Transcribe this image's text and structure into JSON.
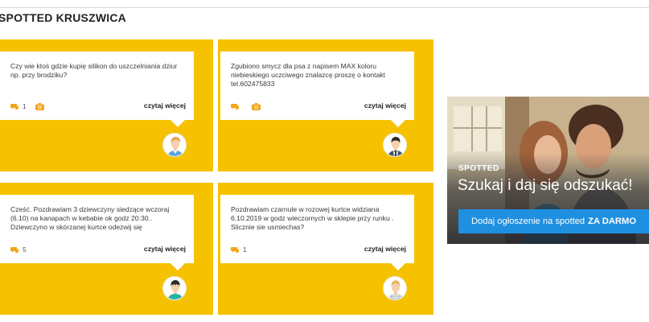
{
  "section": {
    "title": "SPOTTED KRUSZWICA"
  },
  "posts": [
    {
      "text": "Czy wie ktoś gdzie kupię silikon do uszczelniania dziur np. przy brodziku?",
      "comments": "1",
      "has_photo": true,
      "read_more": "czytaj więcej",
      "avatar": "young-man-avatar"
    },
    {
      "text": "Zgubiono smycz dla psa z napisem MAX koloru niebieskiego uczciwego znalazcę proszę o kontakt tel.602475833",
      "comments": "",
      "has_photo": true,
      "read_more": "czytaj więcej",
      "avatar": "businessman-avatar"
    },
    {
      "text": "Cześć. Pozdrawiam 3 dziewczyny siedzące wczoraj (6.10) na kanapach w kebabie ok godz 20:30.. Dziewczyno w skórzanej kurtce odezwij się",
      "comments": "5",
      "has_photo": false,
      "read_more": "czytaj więcej",
      "avatar": "teal-shirt-avatar"
    },
    {
      "text": "Pozdrawiam czarnule w rozowej kurtce widziana 6.10.2019 w godz wieczornych w sklepie przy runku . Slicznie sie usmiechas?",
      "comments": "1",
      "has_photo": false,
      "read_more": "czytaj więcej",
      "avatar": "blond-man-avatar"
    }
  ],
  "ad": {
    "kicker": "SPOTTED",
    "headline": "Szukaj i daj się odszukać!",
    "cta_prefix": "Dodaj ogłoszenie na spotted",
    "cta_strong": "ZA DARMO"
  },
  "colors": {
    "card": "#f6c200",
    "icon_orange": "#f2a51a",
    "cta_blue": "#1f8fe0"
  }
}
